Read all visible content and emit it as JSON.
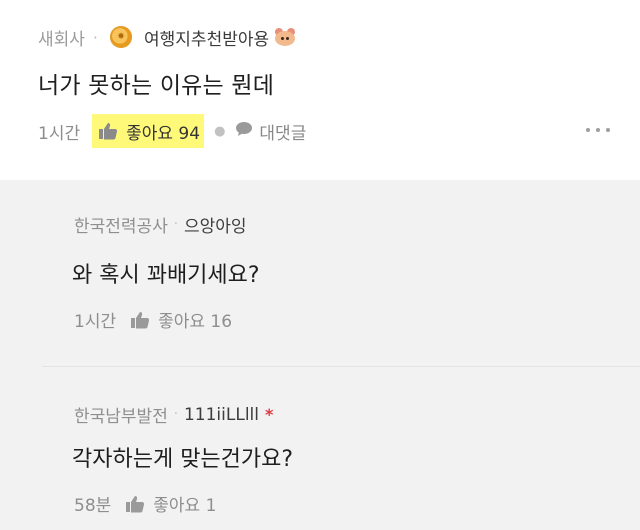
{
  "top_comment": {
    "company": "새회사",
    "nickname": "여행지추천받아용",
    "text": "너가 못하는 이유는 뭔데",
    "time": "1시간",
    "like_label": "좋아요 94",
    "reply_label": "대댓글"
  },
  "replies": [
    {
      "company": "한국전력공사",
      "nickname": "으앙아잉",
      "text": "와 혹시 꽈배기세요?",
      "time": "1시간",
      "like_label": "좋아요 16"
    },
    {
      "company": "한국남부발전",
      "nickname": "111iiLLlll",
      "badge": "*",
      "text": "각자하는게 맞는건가요?",
      "time": "58분",
      "like_label": "좋아요 1"
    }
  ],
  "colors": {
    "highlight": "#fff97a",
    "background": "#f2f2f2",
    "badge_star": "#e0383e"
  },
  "icons": {
    "like": "thumbs-up-icon",
    "reply": "speech-bubble-icon",
    "more": "more-dots-icon",
    "medal": "medal-icon",
    "avatar": "hamster-emoji-icon"
  }
}
